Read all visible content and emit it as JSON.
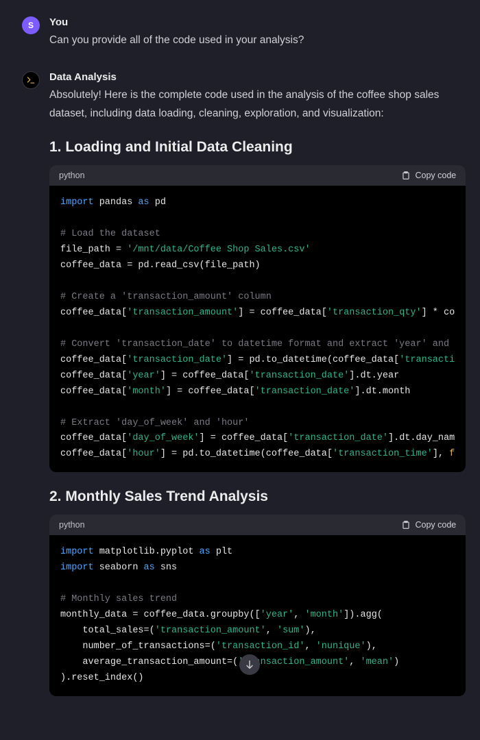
{
  "user": {
    "avatar_initial": "S",
    "sender_label": "You",
    "message": "Can you provide all of the code used in your analysis?"
  },
  "assistant": {
    "sender_label": "Data Analysis",
    "intro": "Absolutely! Here is the complete code used in the analysis of the coffee shop sales dataset, including data loading, cleaning, exploration, and visualization:",
    "section1": {
      "heading": "1. Loading and Initial Data Cleaning",
      "lang": "python",
      "copy_label": "Copy code",
      "code": {
        "l1_kw": "import",
        "l1_mid": " pandas ",
        "l1_as": "as",
        "l1_alias": " pd",
        "l3_cm": "# Load the dataset",
        "l4_a": "file_path = ",
        "l4_str": "'/mnt/data/Coffee Shop Sales.csv'",
        "l5": "coffee_data = pd.read_csv(file_path)",
        "l7_cm": "# Create a 'transaction_amount' column",
        "l8_a": "coffee_data[",
        "l8_str1": "'transaction_amount'",
        "l8_b": "] = coffee_data[",
        "l8_str2": "'transaction_qty'",
        "l8_c": "] * co",
        "l10_cm": "# Convert 'transaction_date' to datetime format and extract 'year' and ",
        "l11_a": "coffee_data[",
        "l11_str1": "'transaction_date'",
        "l11_b": "] = pd.to_datetime(coffee_data[",
        "l11_str2": "'transacti",
        "l12_a": "coffee_data[",
        "l12_str1": "'year'",
        "l12_b": "] = coffee_data[",
        "l12_str2": "'transaction_date'",
        "l12_c": "].dt.year",
        "l13_a": "coffee_data[",
        "l13_str1": "'month'",
        "l13_b": "] = coffee_data[",
        "l13_str2": "'transaction_date'",
        "l13_c": "].dt.month",
        "l15_cm": "# Extract 'day_of_week' and 'hour'",
        "l16_a": "coffee_data[",
        "l16_str1": "'day_of_week'",
        "l16_b": "] = coffee_data[",
        "l16_str2": "'transaction_date'",
        "l16_c": "].dt.day_nam",
        "l17_a": "coffee_data[",
        "l17_str1": "'hour'",
        "l17_b": "] = pd.to_datetime(coffee_data[",
        "l17_str2": "'transaction_time'",
        "l17_c": "], ",
        "l17_str3": "f"
      }
    },
    "section2": {
      "heading": "2. Monthly Sales Trend Analysis",
      "lang": "python",
      "copy_label": "Copy code",
      "code": {
        "l1_kw": "import",
        "l1_mid": " matplotlib.pyplot ",
        "l1_as": "as",
        "l1_alias": " plt",
        "l2_kw": "import",
        "l2_mid": " seaborn ",
        "l2_as": "as",
        "l2_alias": " sns",
        "l4_cm": "# Monthly sales trend",
        "l5_a": "monthly_data = coffee_data.groupby([",
        "l5_str1": "'year'",
        "l5_b": ", ",
        "l5_str2": "'month'",
        "l5_c": "]).agg(",
        "l6_a": "    total_sales=(",
        "l6_str1": "'transaction_amount'",
        "l6_b": ", ",
        "l6_str2": "'sum'",
        "l6_c": "),",
        "l7_a": "    number_of_transactions=(",
        "l7_str1": "'transaction_id'",
        "l7_b": ", ",
        "l7_str2": "'nunique'",
        "l7_c": "),",
        "l8_a": "    average_transaction_amount=(",
        "l8_str1": "'transaction_amount'",
        "l8_b": ", ",
        "l8_str2": "'mean'",
        "l8_c": ")",
        "l9": ").reset_index()"
      }
    }
  }
}
